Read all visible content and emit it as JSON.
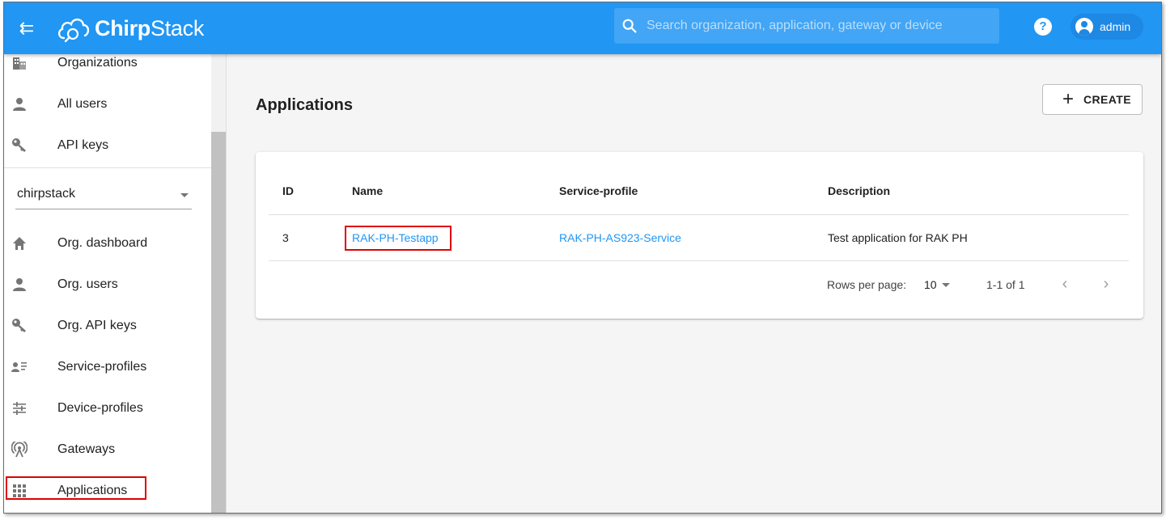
{
  "header": {
    "brand_bold": "Chirp",
    "brand_regular": "Stack",
    "search_placeholder": "Search organization, application, gateway or device",
    "help_label": "?",
    "user_name": "admin"
  },
  "sidebar": {
    "items_top": [
      {
        "label": "Organizations",
        "icon": "building-icon"
      },
      {
        "label": "All users",
        "icon": "person-icon"
      },
      {
        "label": "API keys",
        "icon": "key-icon"
      }
    ],
    "organization_select": "chirpstack",
    "items_org": [
      {
        "label": "Org. dashboard",
        "icon": "home-icon"
      },
      {
        "label": "Org. users",
        "icon": "person-icon"
      },
      {
        "label": "Org. API keys",
        "icon": "key-icon"
      },
      {
        "label": "Service-profiles",
        "icon": "account-details-icon"
      },
      {
        "label": "Device-profiles",
        "icon": "tune-icon"
      },
      {
        "label": "Gateways",
        "icon": "radio-tower-icon"
      },
      {
        "label": "Applications",
        "icon": "apps-icon"
      }
    ]
  },
  "main": {
    "title": "Applications",
    "create_label": "CREATE",
    "table": {
      "columns": [
        "ID",
        "Name",
        "Service-profile",
        "Description"
      ],
      "rows": [
        {
          "id": "3",
          "name": "RAK-PH-Testapp",
          "service_profile": "RAK-PH-AS923-Service",
          "description": "Test application for RAK PH"
        }
      ]
    },
    "pagination": {
      "rows_per_page_label": "Rows per page:",
      "rows_per_page": "10",
      "range": "1-1 of 1",
      "prev": "‹",
      "next": "›"
    }
  },
  "colors": {
    "header": "#2196f3",
    "link": "#2196f3",
    "highlight": "#e00000"
  }
}
